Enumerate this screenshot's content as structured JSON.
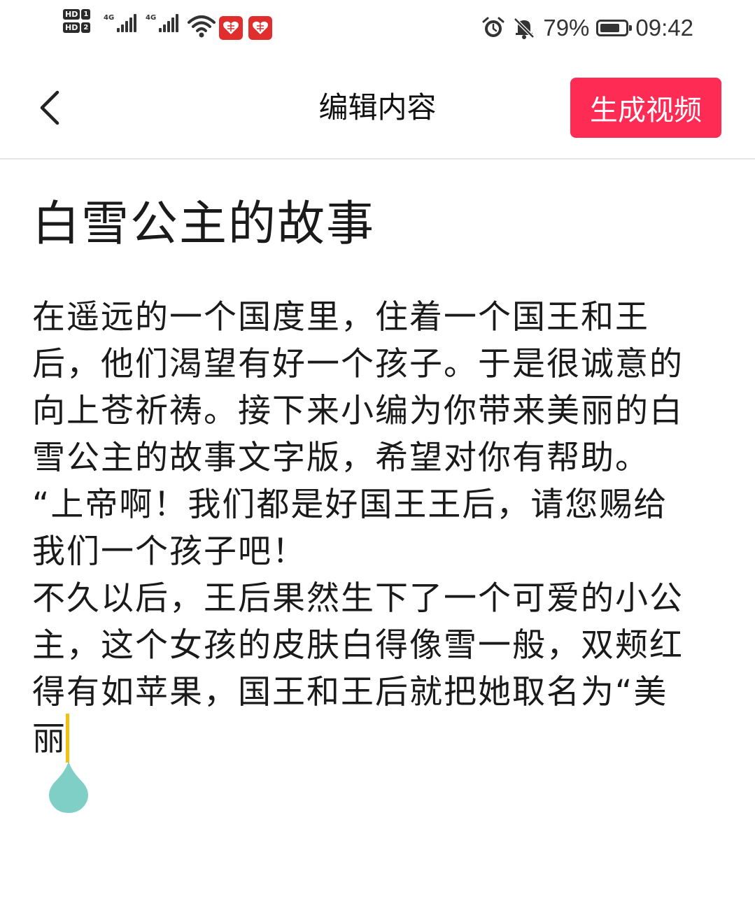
{
  "status_bar": {
    "sim1_label": "HD",
    "sim1_num": "1",
    "sim2_label": "HD",
    "sim2_num": "2",
    "network1": "4G",
    "network2": "4G",
    "battery_percent": "79%",
    "battery_level": 0.79,
    "time": "09:42",
    "icons": [
      "alarm-icon",
      "mute-bell-icon",
      "battery-icon",
      "wifi-icon",
      "app-notification-icon"
    ]
  },
  "header": {
    "title": "编辑内容",
    "generate_label": "生成视频",
    "back_icon": "chevron-left-icon"
  },
  "document": {
    "title": "白雪公主的故事",
    "lines": [
      "在遥远的一个国度里，住着一个国王和王",
      "后，他们渴望有好一个孩子。于是很诚意的",
      "向上苍祈祷。接下来小编为你带来美丽的白",
      "雪公主的故事文字版，希望对你有帮助。",
      "“上帝啊！我们都是好国王王后，请您赐给",
      "我们一个孩子吧！",
      "不久以后，王后果然生下了一个可爱的小公",
      "主，这个女孩的皮肤白得像雪一般，双颊红",
      "得有如苹果，国王和王后就把她取名为“美",
      "丽"
    ]
  },
  "colors": {
    "accent": "#fe2c55",
    "cursor": "#f2c010",
    "handle": "#7fcfc6",
    "divider": "#e6e6e6"
  }
}
